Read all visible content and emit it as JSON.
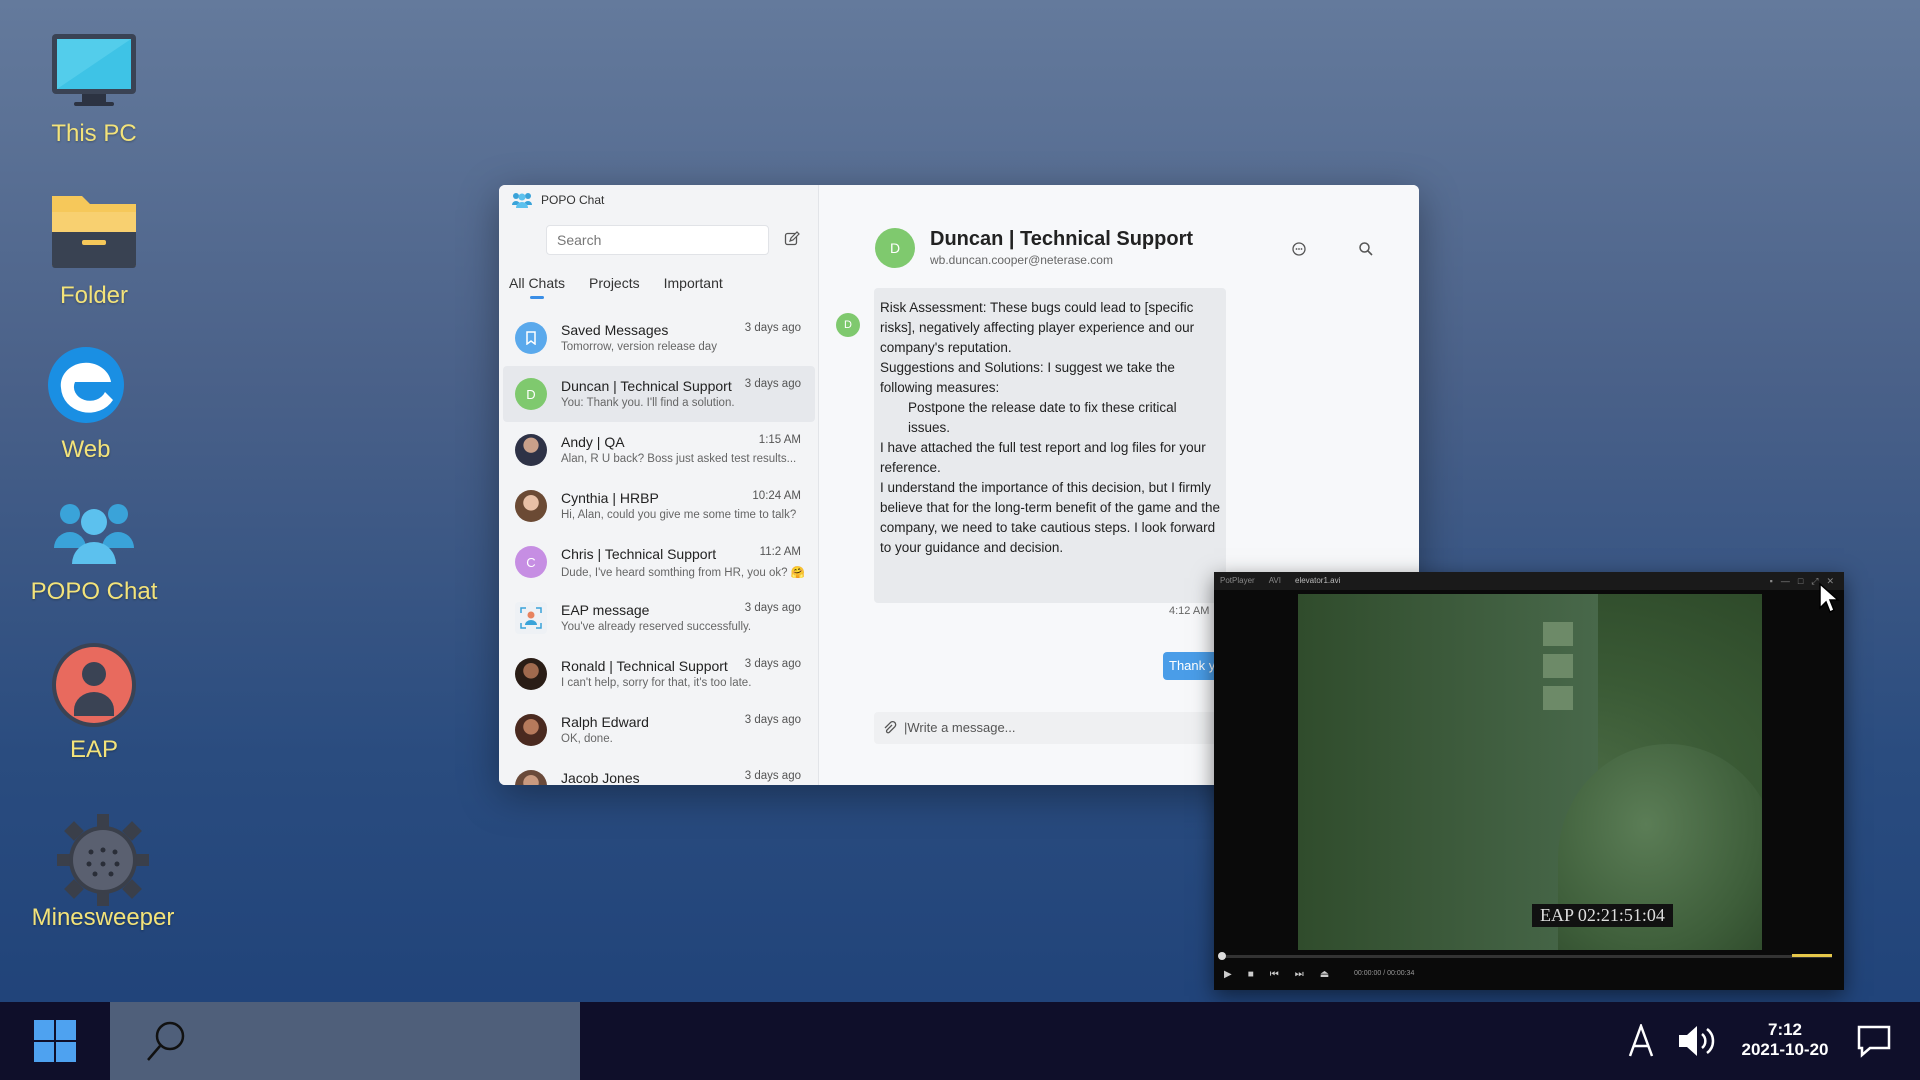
{
  "desktop": {
    "icons": [
      {
        "label": "This PC"
      },
      {
        "label": "Folder"
      },
      {
        "label": "Web"
      },
      {
        "label": "POPO Chat"
      },
      {
        "label": "EAP"
      },
      {
        "label": "Minesweeper"
      }
    ]
  },
  "chat_app": {
    "title": "POPO Chat",
    "search_placeholder": "Search",
    "tabs": [
      {
        "label": "All Chats",
        "active": true
      },
      {
        "label": "Projects"
      },
      {
        "label": "Important"
      }
    ],
    "conversations": [
      {
        "name": "Saved Messages",
        "preview": "Tomorrow, version release day",
        "time": "3 days ago",
        "avatar_color": "#5aa9ec"
      },
      {
        "name": "Duncan | Technical Support",
        "preview": "You: Thank you. I'll find a solution.",
        "time": "3 days ago",
        "avatar_letter": "D",
        "avatar_color": "#7fc96e",
        "selected": true
      },
      {
        "name": "Andy | QA",
        "preview": "Alan, R U back? Boss just asked test results...",
        "time": "1:15 AM",
        "avatar_color": "#3b3f52"
      },
      {
        "name": "Cynthia | HRBP",
        "preview": "Hi, Alan, could you give me some time to talk?",
        "time": "10:24 AM",
        "avatar_color": "#8a6b4f"
      },
      {
        "name": "Chris | Technical Support",
        "preview": "Dude, I've heard somthing from HR, you ok? 🤗",
        "time": "11:2 AM",
        "avatar_letter": "C",
        "avatar_color": "#c68ee3"
      },
      {
        "name": "EAP message",
        "preview": "You've already reserved successfully.",
        "time": "3 days ago",
        "avatar_color": "#e0e4ea"
      },
      {
        "name": "Ronald | Technical Support",
        "preview": "I can't help, sorry for that, it's too late.",
        "time": "3 days ago",
        "avatar_color": "#4a3528"
      },
      {
        "name": "Ralph Edward",
        "preview": "OK, done.",
        "time": "3 days ago",
        "avatar_color": "#7a4a35"
      },
      {
        "name": "Jacob Jones",
        "preview": "",
        "time": "3 days ago",
        "avatar_color": "#9a7a6a"
      }
    ],
    "active_chat": {
      "name": "Duncan | Technical Support",
      "email": "wb.duncan.cooper@neterase.com",
      "avatar_letter": "D",
      "message_lines": [
        "Risk Assessment: These bugs could lead to [specific risks], negatively affecting player experience and our company's reputation.",
        "Suggestions and Solutions: I suggest we take the following measures:",
        "Postpone the release date to fix these critical issues.",
        "I have attached the full test report and log files for your reference.",
        "I understand the importance of this decision, but I firmly believe that for the long-term benefit of the game and the company, we need to take cautious steps. I look forward to your guidance and decision."
      ],
      "message_time": "4:12 AM",
      "sent_preview": "Thank y",
      "input_placeholder": "|Write a message..."
    }
  },
  "player": {
    "app_name": "PotPlayer",
    "format": "AVI",
    "filename": "elevator1.avi",
    "timestamp_overlay": "EAP 02:21:51:04",
    "time_readout": "00:00:00 / 00:00:34",
    "progress": 0.0
  },
  "taskbar": {
    "time": "7:12",
    "date": "2021-10-20"
  }
}
